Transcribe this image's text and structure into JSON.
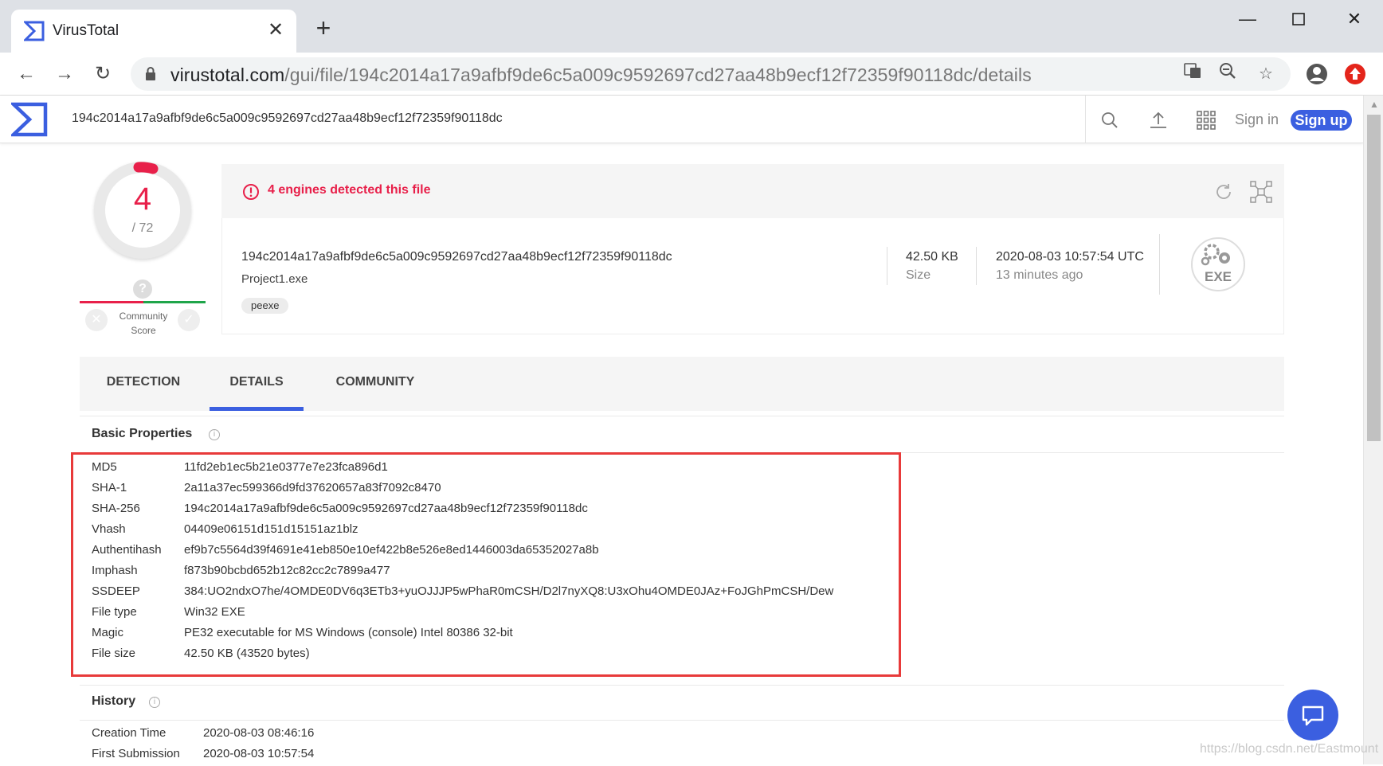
{
  "browser": {
    "tab_title": "VirusTotal",
    "url_host": "virustotal.com",
    "url_path": "/gui/file/194c2014a17a9afbf9de6c5a009c9592697cd27aa48b9ecf12f72359f90118dc/details"
  },
  "header": {
    "search_value": "194c2014a17a9afbf9de6c5a009c9592697cd27aa48b9ecf12f72359f90118dc",
    "sign_in": "Sign in",
    "sign_up": "Sign up"
  },
  "score": {
    "detections": "4",
    "total": "/ 72",
    "community_label_1": "Community",
    "community_label_2": "Score",
    "community_unknown": "?"
  },
  "detection": {
    "banner_text": "4 engines detected this file"
  },
  "file": {
    "hash": "194c2014a17a9afbf9de6c5a009c9592697cd27aa48b9ecf12f72359f90118dc",
    "name": "Project1.exe",
    "tag": "peexe",
    "size_value": "42.50 KB",
    "size_label": "Size",
    "date_value": "2020-08-03 10:57:54 UTC",
    "date_label": "13 minutes ago",
    "type_badge": "EXE"
  },
  "tabs": [
    "DETECTION",
    "DETAILS",
    "COMMUNITY"
  ],
  "basic_properties": {
    "title": "Basic Properties",
    "rows": [
      {
        "key": "MD5",
        "value": "11fd2eb1ec5b21e0377e7e23fca896d1"
      },
      {
        "key": "SHA-1",
        "value": "2a11a37ec599366d9fd37620657a83f7092c8470"
      },
      {
        "key": "SHA-256",
        "value": "194c2014a17a9afbf9de6c5a009c9592697cd27aa48b9ecf12f72359f90118dc"
      },
      {
        "key": "Vhash",
        "value": "04409e06151d151d15151az1blz"
      },
      {
        "key": "Authentihash",
        "value": "ef9b7c5564d39f4691e41eb850e10ef422b8e526e8ed1446003da65352027a8b"
      },
      {
        "key": "Imphash",
        "value": "f873b90bcbd652b12c82cc2c7899a477"
      },
      {
        "key": "SSDEEP",
        "value": "384:UO2ndxO7he/4OMDE0DV6q3ETb3+yuOJJJP5wPhaR0mCSH/D2l7nyXQ8:U3xOhu4OMDE0JAz+FoJGhPmCSH/Dew"
      },
      {
        "key": "File type",
        "value": "Win32 EXE"
      },
      {
        "key": "Magic",
        "value": "PE32 executable for MS Windows (console) Intel 80386 32-bit"
      },
      {
        "key": "File size",
        "value": "42.50 KB (43520 bytes)"
      }
    ]
  },
  "history": {
    "title": "History",
    "rows": [
      {
        "key": "Creation Time",
        "value": "2020-08-03 08:46:16"
      },
      {
        "key": "First Submission",
        "value": "2020-08-03 10:57:54"
      }
    ]
  },
  "watermark": "https://blog.csdn.net/Eastmount",
  "colors": {
    "accent": "#3b5fe0",
    "danger": "#e8204a",
    "ok": "#1fa54a",
    "highlight_box": "#e83a3a"
  }
}
